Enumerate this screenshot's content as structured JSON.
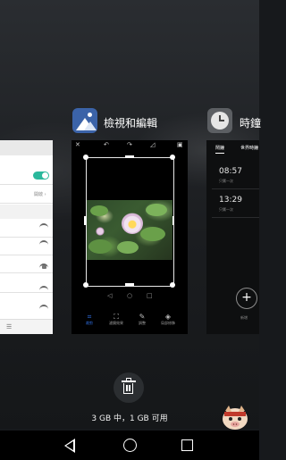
{
  "recents": {
    "center_app": {
      "name": "檢視和編輯",
      "icon": "gallery-icon"
    },
    "right_app": {
      "name": "時鐘",
      "icon": "clock-icon"
    },
    "left_app": {
      "icon": "settings-app",
      "toggle_state": "on"
    }
  },
  "photo_editor": {
    "top_icons": [
      "close-icon",
      "undo-icon",
      "redo-icon",
      "compare-icon",
      "save-icon"
    ],
    "tools": [
      {
        "icon": "crop-icon",
        "label": "裁剪",
        "active": true
      },
      {
        "icon": "filter-icon",
        "label": "濾鏡效果",
        "active": false
      },
      {
        "icon": "adjust-icon",
        "label": "調整",
        "active": false
      },
      {
        "icon": "eraser-icon",
        "label": "局部修飾",
        "active": false
      }
    ]
  },
  "clock": {
    "tabs": [
      "鬧鐘",
      "世界時鐘"
    ],
    "alarms": [
      {
        "time": "08:57",
        "repeat": "只響一次"
      },
      {
        "time": "13:29",
        "repeat": "只響一次"
      }
    ],
    "add_label": "新增"
  },
  "memory_status": "3 GB 中，1 GB 可用",
  "colors": {
    "accent": "#2f6fe3",
    "toggle": "#2ab89c",
    "background": "#17191c"
  },
  "navbar": [
    "back-icon",
    "home-icon",
    "recent-apps-icon"
  ]
}
